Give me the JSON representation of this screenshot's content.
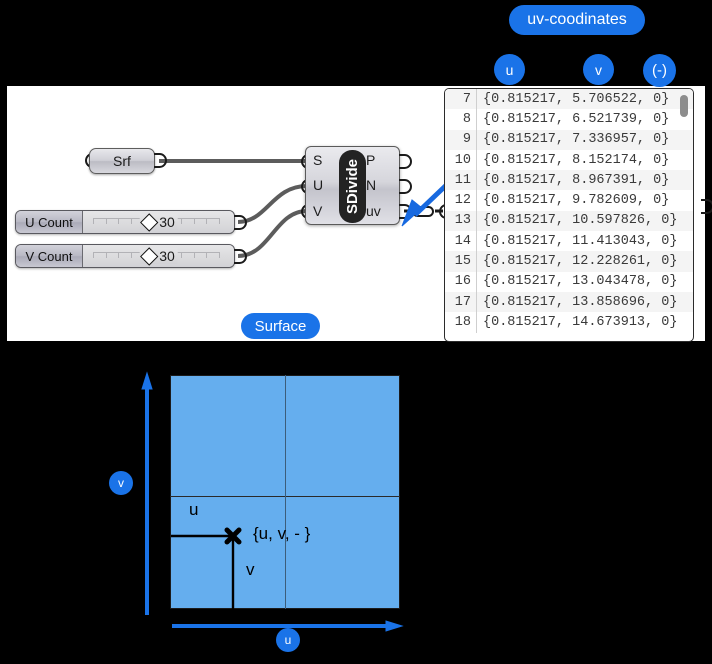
{
  "canvas": {
    "srf_node": {
      "label": "Srf"
    },
    "sliders": [
      {
        "name": "U Count",
        "value": "30"
      },
      {
        "name": "V Count",
        "value": "30"
      }
    ],
    "component": {
      "title": "SDivide",
      "inputs": [
        "S",
        "U",
        "V"
      ],
      "outputs": [
        "P",
        "N",
        "uv"
      ]
    }
  },
  "panel": {
    "rows": [
      {
        "index": "7",
        "value": "{0.815217, 5.706522, 0}"
      },
      {
        "index": "8",
        "value": "{0.815217, 6.521739, 0}"
      },
      {
        "index": "9",
        "value": "{0.815217, 7.336957, 0}"
      },
      {
        "index": "10",
        "value": "{0.815217, 8.152174, 0}"
      },
      {
        "index": "11",
        "value": "{0.815217, 8.967391, 0}"
      },
      {
        "index": "12",
        "value": "{0.815217, 9.782609, 0}"
      },
      {
        "index": "13",
        "value": "{0.815217, 10.597826, 0}"
      },
      {
        "index": "14",
        "value": "{0.815217, 11.413043, 0}"
      },
      {
        "index": "15",
        "value": "{0.815217, 12.228261, 0}"
      },
      {
        "index": "16",
        "value": "{0.815217, 13.043478, 0}"
      },
      {
        "index": "17",
        "value": "{0.815217, 13.858696, 0}"
      },
      {
        "index": "18",
        "value": "{0.815217, 14.673913, 0}"
      }
    ]
  },
  "annotations": {
    "uv_coordinates": "uv-coodinates",
    "column_u": "u",
    "column_v": "v",
    "column_dash": "(-)",
    "surface": "Surface"
  },
  "diagram": {
    "axis_v": "v",
    "axis_u": "u",
    "label_u": "u",
    "label_v": "v",
    "tuple": "{u, v, - }"
  },
  "colors": {
    "accent_blue": "#1a73e8",
    "surface_fill": "#65aeee",
    "arrow_blue": "#1769e0",
    "background": "#000000"
  }
}
